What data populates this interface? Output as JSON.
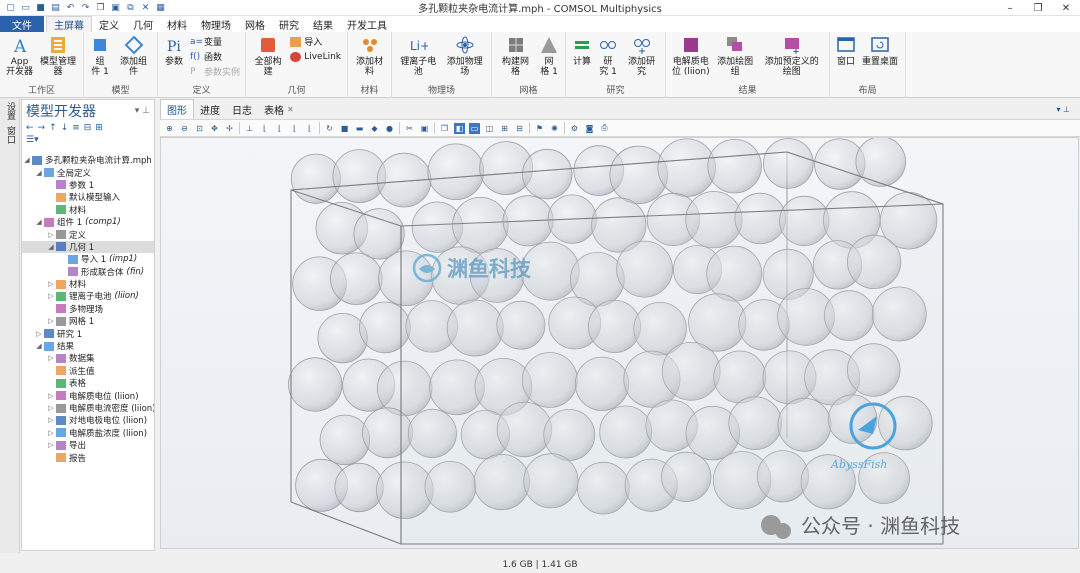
{
  "window": {
    "title": "多孔颗粒夹杂电流计算.mph - COMSOL Multiphysics"
  },
  "ribbon_tabs": [
    "文件",
    "主屏幕",
    "定义",
    "几何",
    "材料",
    "物理场",
    "网格",
    "研究",
    "结果",
    "开发工具"
  ],
  "ribbon": {
    "groups": {
      "workspace": "工作区",
      "model": "模型",
      "definitions": "定义",
      "geometry": "几何",
      "materials": "材料",
      "physics": "物理场",
      "mesh": "网格",
      "study": "研究",
      "results": "结果",
      "layout": "布局"
    },
    "buttons": {
      "app_builder": "App\n开发器",
      "model_manager": "模型管理器",
      "component": "组\n件 1",
      "add_component": "添加组件",
      "parameters": "参数",
      "variables": "变量",
      "functions": "函数",
      "param_case": "参数实例",
      "build_all": "全部构建",
      "import": "导入",
      "livelink": "LiveLink",
      "add_material": "添加材料",
      "li_battery": "锂离子电池",
      "add_physics": "添加物理场",
      "build_mesh": "构建网格",
      "mesh1": "网\n格 1",
      "compute": "计算",
      "study1": "研\n究 1",
      "add_study": "添加研究",
      "electrolyte_potential": "电解质电\n位 (liion)",
      "add_plot_group": "添加绘图组",
      "add_predefined_plot": "添加预定义的绘图",
      "windows": "窗口",
      "reset_desktop": "重置桌面"
    }
  },
  "side_strip": [
    "设置",
    "窗口"
  ],
  "model_builder": {
    "title": "模型开发器",
    "tree": [
      {
        "label": "多孔颗粒夹杂电流计算.mph",
        "tag": "",
        "indent": 0,
        "expand": "▼"
      },
      {
        "label": "全局定义",
        "tag": "",
        "indent": 1,
        "expand": "▼"
      },
      {
        "label": "参数 1",
        "tag": "",
        "indent": 2,
        "expand": ""
      },
      {
        "label": "默认模型输入",
        "tag": "",
        "indent": 2,
        "expand": ""
      },
      {
        "label": "材料",
        "tag": "",
        "indent": 2,
        "expand": ""
      },
      {
        "label": "组件 1",
        "tag": "(comp1)",
        "indent": 1,
        "expand": "▼"
      },
      {
        "label": "定义",
        "tag": "",
        "indent": 2,
        "expand": "▶"
      },
      {
        "label": "几何 1",
        "tag": "",
        "indent": 2,
        "expand": "▼",
        "selected": true
      },
      {
        "label": "导入 1",
        "tag": "(imp1)",
        "indent": 3,
        "expand": ""
      },
      {
        "label": "形成联合体",
        "tag": "(fin)",
        "indent": 3,
        "expand": ""
      },
      {
        "label": "材料",
        "tag": "",
        "indent": 2,
        "expand": "▶"
      },
      {
        "label": "锂离子电池",
        "tag": "(liion)",
        "indent": 2,
        "expand": "▶"
      },
      {
        "label": "多物理场",
        "tag": "",
        "indent": 2,
        "expand": ""
      },
      {
        "label": "网格 1",
        "tag": "",
        "indent": 2,
        "expand": "▶"
      },
      {
        "label": "研究 1",
        "tag": "",
        "indent": 1,
        "expand": "▶"
      },
      {
        "label": "结果",
        "tag": "",
        "indent": 1,
        "expand": "▼"
      },
      {
        "label": "数据集",
        "tag": "",
        "indent": 2,
        "expand": "▶"
      },
      {
        "label": "派生值",
        "tag": "",
        "indent": 2,
        "expand": ""
      },
      {
        "label": "表格",
        "tag": "",
        "indent": 2,
        "expand": ""
      },
      {
        "label": "电解质电位 (liion)",
        "tag": "",
        "indent": 2,
        "expand": "▶"
      },
      {
        "label": "电解质电流密度 (liion)",
        "tag": "",
        "indent": 2,
        "expand": "▶"
      },
      {
        "label": "对地电极电位 (liion)",
        "tag": "",
        "indent": 2,
        "expand": "▶"
      },
      {
        "label": "电解质盐浓度 (liion)",
        "tag": "",
        "indent": 2,
        "expand": "▶"
      },
      {
        "label": "导出",
        "tag": "",
        "indent": 2,
        "expand": "▶"
      },
      {
        "label": "报告",
        "tag": "",
        "indent": 2,
        "expand": ""
      }
    ]
  },
  "graphics": {
    "tabs": [
      "图形",
      "进度",
      "日志",
      "表格"
    ],
    "watermark_brand": "渊鱼科技",
    "watermark_logo_text": "AbyssFish",
    "wechat_watermark": "公众号 · 渊鱼科技"
  },
  "status_bar": {
    "memory": "1.6 GB | 1.41 GB"
  },
  "colors": {
    "accent": "#2a62ad",
    "sphere_fill": "#c9cdd3",
    "box_edge": "#8a8a8a"
  }
}
